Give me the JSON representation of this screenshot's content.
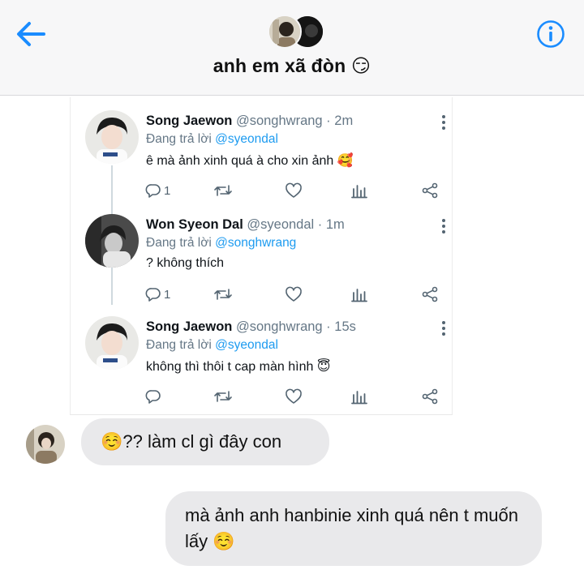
{
  "header": {
    "title": "anh em xã đòn 😏",
    "back_icon": "back-arrow-icon",
    "info_icon": "info-icon",
    "accent_color": "#1a8cff"
  },
  "tweet_card": {
    "tweets": [
      {
        "display_name": "Song Jaewon",
        "meta": "@songhwrang · 2m",
        "replying_prefix": "Đang trả lời",
        "replying_to": "@syeondal",
        "text": "ê mà ảnh xinh quá à cho xin ảnh 🥰",
        "reply_count": "1",
        "retweet_count": "",
        "like_count": ""
      },
      {
        "display_name": "Won Syeon Dal",
        "meta": "@syeondal · 1m",
        "replying_prefix": "Đang trả lời",
        "replying_to": "@songhwrang",
        "text": "? không thích",
        "reply_count": "1",
        "retweet_count": "",
        "like_count": ""
      },
      {
        "display_name": "Song Jaewon",
        "meta": "@songhwrang · 15s",
        "replying_prefix": "Đang trả lời",
        "replying_to": "@syeondal",
        "text": "không thì thôi t cap màn hình 😇",
        "reply_count": "",
        "retweet_count": "",
        "like_count": ""
      }
    ],
    "mention_color": "#1d9bf0"
  },
  "messages": [
    {
      "direction": "incoming",
      "text": "☺️?? làm cl gì đây con"
    },
    {
      "direction": "outgoing",
      "text": "mà ảnh anh hanbinie xinh quá nên t muốn lấy ☺️"
    }
  ]
}
